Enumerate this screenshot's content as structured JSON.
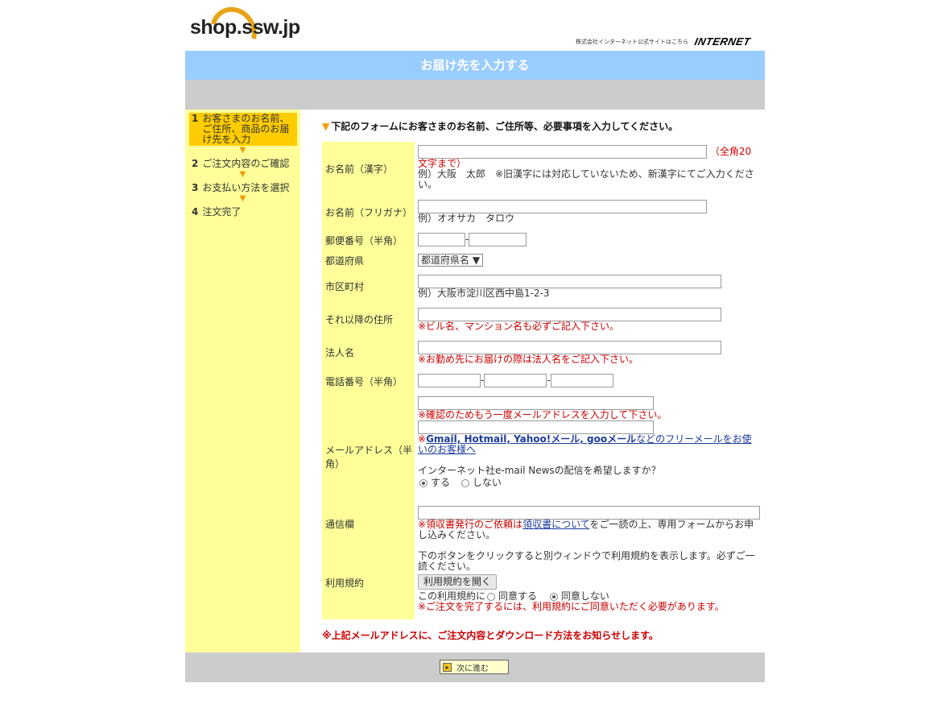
{
  "header": {
    "logo_text": "shop.ssw.jp",
    "corp_link_text": "株式会社インターネット公式サイトはこちら",
    "corp_logo": "INTERNET"
  },
  "title": "お届け先を入力する",
  "sidebar": {
    "steps": [
      {
        "num": "1",
        "label": "お客さまのお名前、ご住所、商品のお届け先を入力"
      },
      {
        "num": "2",
        "label": "ご注文内容のご確認"
      },
      {
        "num": "3",
        "label": "お支払い方法を選択"
      },
      {
        "num": "4",
        "label": "注文完了"
      }
    ],
    "arrow": "▼"
  },
  "lead": "下記のフォームにお客さまのお名前、ご住所等、必要事項を入力してください。",
  "lead_icon": "▼",
  "form": {
    "name_kanji": {
      "label": "お名前（漢字）",
      "note": "（全角20文字まで）",
      "example": "例）大阪　太郎　※旧漢字には対応していないため、新漢字にてご入力ください。"
    },
    "name_kana": {
      "label": "お名前（フリガナ）",
      "example": "例）オオサカ　タロウ"
    },
    "postal": {
      "label": "郵便番号（半角）",
      "sep": "-"
    },
    "prefecture": {
      "label": "都道府県",
      "selected": "都道府県名"
    },
    "city": {
      "label": "市区町村",
      "example": "例）大阪市淀川区西中島1-2-3"
    },
    "address": {
      "label": "それ以降の住所",
      "note": "※ビル名、マンション名も必ずご記入下さい。"
    },
    "company": {
      "label": "法人名",
      "note": "※お勤め先にお届けの際は法人名をご記入下さい。"
    },
    "phone": {
      "label": "電話番号（半角）",
      "sep": "-"
    },
    "email": {
      "label": "メールアドレス（半角）",
      "confirm_note": "※確認のためもう一度メールアドレスを入力して下さい。",
      "free_mail_prefix": "※",
      "free_mail_bold": "Gmail, Hotmail, Yahoo!メール, gooメール",
      "free_mail_link": "などのフリーメールをお使いのお客様へ",
      "newsletter_q": "インターネット社e-mail Newsの配信を希望しますか？",
      "opt_yes": "する",
      "opt_no": "しない"
    },
    "comments": {
      "label": "通信欄",
      "note_prefix": "※領収書発行のご依頼は",
      "note_link": "領収書について",
      "note_suffix": "をご一読の上、専用フォームからお申し込みください。"
    },
    "terms": {
      "label": "利用規約",
      "desc": "下のボタンをクリックすると別ウィンドウで利用規約を表示します。必ずご一読ください。",
      "button": "利用規約を開く",
      "agree_prefix": "この利用規約に",
      "agree": "同意する",
      "disagree": "同意しない",
      "note": "※ご注文を完了するには、利用規約にご同意いただく必要があります。"
    }
  },
  "footnote": "※上記メールアドレスに、ご注文内容とダウンロード方法をお知らせします。",
  "next_button": "次に進む"
}
